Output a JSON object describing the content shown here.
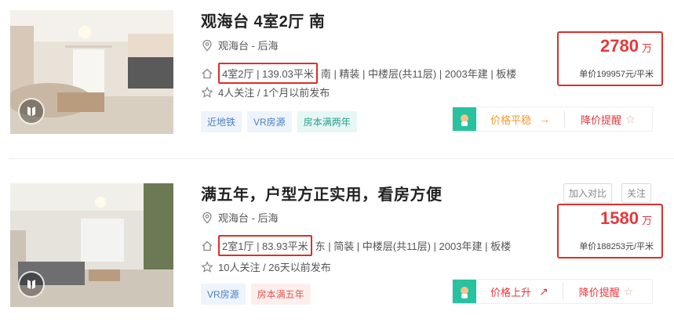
{
  "listings": [
    {
      "title": "观海台 4室2厅 南",
      "location": "观海台 - 后海",
      "rooms_area": "4室2厅 | 139.03平米",
      "details": "南 | 精装 | 中楼层(共11层) | 2003年建 | 板楼",
      "follow": "4人关注 / 1个月以前发布",
      "tags": [
        {
          "label": "近地铁",
          "style": "blue"
        },
        {
          "label": "VR房源",
          "style": "blue"
        },
        {
          "label": "房本满两年",
          "style": "teal"
        }
      ],
      "price": "2780",
      "price_unit": "万",
      "unit_price": "单价199957元/平米",
      "trend": "价格平稳",
      "trend_arrow": "→",
      "alert": "降价提醒"
    },
    {
      "title": "满五年，户型方正实用，看房方便",
      "compare_label": "加入对比",
      "follow_label": "关注",
      "location": "观海台 - 后海",
      "rooms_area": "2室1厅 | 83.93平米",
      "details": "东 | 简装 | 中楼层(共11层) | 2003年建 | 板楼",
      "follow": "10人关注 / 26天以前发布",
      "tags": [
        {
          "label": "VR房源",
          "style": "blue"
        },
        {
          "label": "房本满五年",
          "style": "red"
        }
      ],
      "price": "1580",
      "price_unit": "万",
      "unit_price": "单价188253元/平米",
      "trend": "价格上升",
      "trend_arrow": "↗",
      "alert": "降价提醒"
    }
  ],
  "colors": {
    "accent_red": "#e4393c",
    "box_red": "#d9302c",
    "trend_green": "#27c3a0"
  }
}
